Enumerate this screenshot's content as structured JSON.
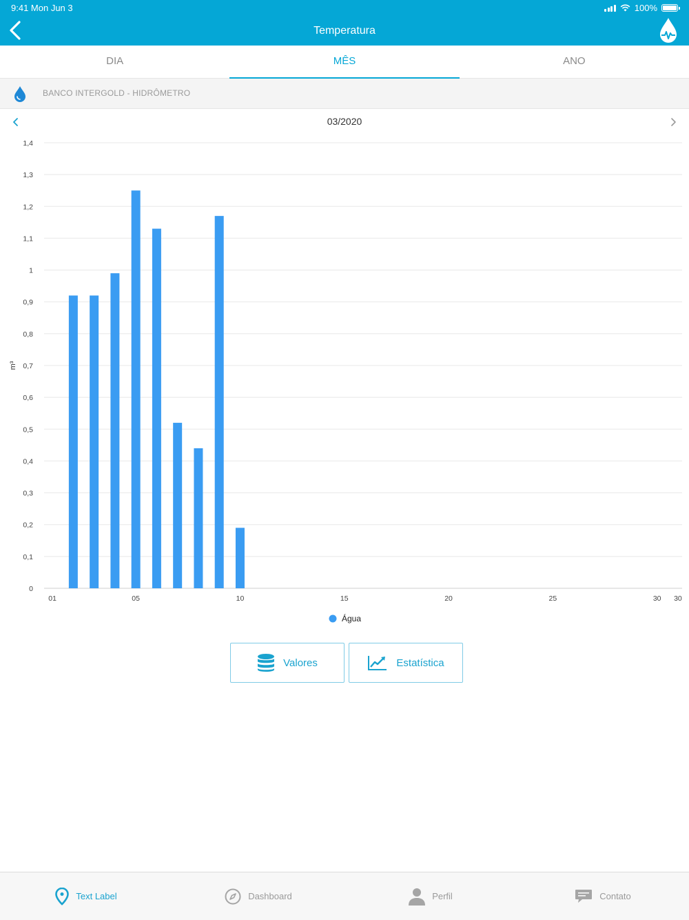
{
  "status_bar": {
    "time": "9:41  Mon Jun 3",
    "battery": "100%"
  },
  "header": {
    "title": "Temperatura",
    "back_icon": "chevron-left-icon",
    "logo_icon": "water-drop-logo-icon"
  },
  "tabs": [
    {
      "label": "DIA",
      "active": false
    },
    {
      "label": "MÊS",
      "active": true
    },
    {
      "label": "ANO",
      "active": false
    }
  ],
  "device": {
    "name": "BANCO INTERGOLD - HIDRÔMETRO",
    "icon": "water-drop-icon",
    "icon_color": "#1e88d6"
  },
  "period": {
    "label": "03/2020"
  },
  "chart_data": {
    "type": "bar",
    "ylabel": "m³",
    "ylim": [
      0,
      1.4
    ],
    "y_ticks": [
      "0",
      "0,1",
      "0,2",
      "0,3",
      "0,4",
      "0,5",
      "0,6",
      "0,7",
      "0,8",
      "0,9",
      "1",
      "1,1",
      "1,2",
      "1,3",
      "1,4"
    ],
    "x_ticks": [
      {
        "day": 1,
        "label": "01"
      },
      {
        "day": 5,
        "label": "05"
      },
      {
        "day": 10,
        "label": "10"
      },
      {
        "day": 15,
        "label": "15"
      },
      {
        "day": 20,
        "label": "20"
      },
      {
        "day": 25,
        "label": "25"
      },
      {
        "day": 30,
        "label": "30"
      },
      {
        "day": 31,
        "label": "30"
      }
    ],
    "xlim": [
      0.6,
      31.2
    ],
    "series": [
      {
        "name": "Água",
        "color": "#3a9cf2",
        "points": [
          {
            "x": 2,
            "y": 0.92
          },
          {
            "x": 3,
            "y": 0.92
          },
          {
            "x": 4,
            "y": 0.99
          },
          {
            "x": 5,
            "y": 1.25
          },
          {
            "x": 6,
            "y": 1.13
          },
          {
            "x": 7,
            "y": 0.52
          },
          {
            "x": 8,
            "y": 0.44
          },
          {
            "x": 9,
            "y": 1.17
          },
          {
            "x": 10,
            "y": 0.19
          }
        ]
      }
    ],
    "grid": true,
    "legend_position": "bottom-center"
  },
  "actions": [
    {
      "label": "Valores",
      "icon": "database-icon"
    },
    {
      "label": "Estatística",
      "icon": "line-chart-icon"
    }
  ],
  "tabbar": [
    {
      "label": "Text Label",
      "icon": "location-pin-icon",
      "active": true
    },
    {
      "label": "Dashboard",
      "icon": "compass-icon",
      "active": false
    },
    {
      "label": "Perfil",
      "icon": "person-icon",
      "active": false
    },
    {
      "label": "Contato",
      "icon": "chat-bubble-icon",
      "active": false
    }
  ],
  "colors": {
    "primary": "#05a7d6",
    "bar": "#3a9cf2",
    "grid": "#e8e8e8"
  }
}
